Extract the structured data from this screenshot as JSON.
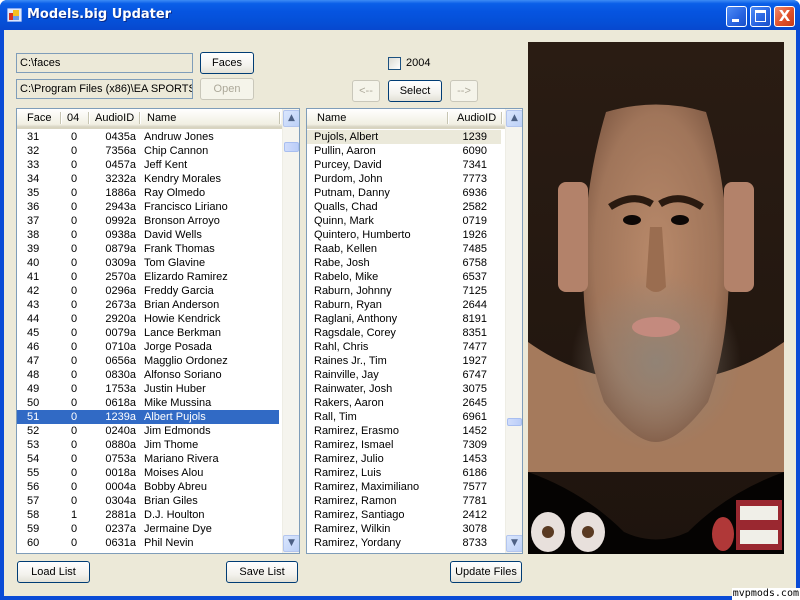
{
  "window": {
    "title": "Models.big Updater",
    "app_icon": "app-window-icon",
    "controls": {
      "minimize": "minimize-icon",
      "maximize": "maximize-icon",
      "close_glyph": "X"
    }
  },
  "paths": {
    "faces_path": "C:\\faces",
    "game_path": "C:\\Program Files (x86)\\EA SPORTS"
  },
  "buttons": {
    "faces": "Faces",
    "open": "Open",
    "prev": "<--",
    "select": "Select",
    "next": "-->",
    "load_list": "Load List",
    "save_list": "Save List",
    "update_files": "Update Files"
  },
  "checkbox_2004": {
    "label": "2004",
    "checked": false
  },
  "face_list": {
    "columns": [
      "Face",
      "04",
      "AudioID",
      "Name"
    ],
    "selected_face": "51",
    "rows": [
      [
        "31",
        "0",
        "0435a",
        "Andruw Jones"
      ],
      [
        "32",
        "0",
        "7356a",
        "Chip Cannon"
      ],
      [
        "33",
        "0",
        "0457a",
        "Jeff Kent"
      ],
      [
        "34",
        "0",
        "3232a",
        "Kendry Morales"
      ],
      [
        "35",
        "0",
        "1886a",
        "Ray Olmedo"
      ],
      [
        "36",
        "0",
        "2943a",
        "Francisco Liriano"
      ],
      [
        "37",
        "0",
        "0992a",
        "Bronson Arroyo"
      ],
      [
        "38",
        "0",
        "0938a",
        "David Wells"
      ],
      [
        "39",
        "0",
        "0879a",
        "Frank Thomas"
      ],
      [
        "40",
        "0",
        "0309a",
        "Tom Glavine"
      ],
      [
        "41",
        "0",
        "2570a",
        "Elizardo Ramirez"
      ],
      [
        "42",
        "0",
        "0296a",
        "Freddy Garcia"
      ],
      [
        "43",
        "0",
        "2673a",
        "Brian Anderson"
      ],
      [
        "44",
        "0",
        "2920a",
        "Howie Kendrick"
      ],
      [
        "45",
        "0",
        "0079a",
        "Lance Berkman"
      ],
      [
        "46",
        "0",
        "0710a",
        "Jorge Posada"
      ],
      [
        "47",
        "0",
        "0656a",
        "Magglio Ordonez"
      ],
      [
        "48",
        "0",
        "0830a",
        "Alfonso Soriano"
      ],
      [
        "49",
        "0",
        "1753a",
        "Justin Huber"
      ],
      [
        "50",
        "0",
        "0618a",
        "Mike Mussina"
      ],
      [
        "51",
        "0",
        "1239a",
        "Albert Pujols"
      ],
      [
        "52",
        "0",
        "0240a",
        "Jim Edmonds"
      ],
      [
        "53",
        "0",
        "0880a",
        "Jim Thome"
      ],
      [
        "54",
        "0",
        "0753a",
        "Mariano Rivera"
      ],
      [
        "55",
        "0",
        "0018a",
        "Moises Alou"
      ],
      [
        "56",
        "0",
        "0004a",
        "Bobby Abreu"
      ],
      [
        "57",
        "0",
        "0304a",
        "Brian Giles"
      ],
      [
        "58",
        "1",
        "2881a",
        "D.J. Houlton"
      ],
      [
        "59",
        "0",
        "0237a",
        "Jermaine Dye"
      ],
      [
        "60",
        "0",
        "0631a",
        "Phil Nevin"
      ]
    ],
    "scroll_position": 0.05
  },
  "audio_list": {
    "columns": [
      "Name",
      "AudioID"
    ],
    "highlighted_name": "Pujols, Albert",
    "rows": [
      [
        "Pujols, Albert",
        "1239"
      ],
      [
        "Pullin, Aaron",
        "6090"
      ],
      [
        "Purcey, David",
        "7341"
      ],
      [
        "Purdom, John",
        "7773"
      ],
      [
        "Putnam, Danny",
        "6936"
      ],
      [
        "Qualls, Chad",
        "2582"
      ],
      [
        "Quinn, Mark",
        "0719"
      ],
      [
        "Quintero, Humberto",
        "1926"
      ],
      [
        "Raab, Kellen",
        "7485"
      ],
      [
        "Rabe, Josh",
        "6758"
      ],
      [
        "Rabelo, Mike",
        "6537"
      ],
      [
        "Raburn, Johnny",
        "7125"
      ],
      [
        "Raburn, Ryan",
        "2644"
      ],
      [
        "Raglani, Anthony",
        "8191"
      ],
      [
        "Ragsdale, Corey",
        "8351"
      ],
      [
        "Rahl, Chris",
        "7477"
      ],
      [
        "Raines Jr., Tim",
        "1927"
      ],
      [
        "Rainville, Jay",
        "6747"
      ],
      [
        "Rainwater, Josh",
        "3075"
      ],
      [
        "Rakers, Aaron",
        "2645"
      ],
      [
        "Rall, Tim",
        "6961"
      ],
      [
        "Ramirez, Erasmo",
        "1452"
      ],
      [
        "Ramirez, Ismael",
        "7309"
      ],
      [
        "Ramirez, Julio",
        "1453"
      ],
      [
        "Ramirez, Luis",
        "6186"
      ],
      [
        "Ramirez, Maximiliano",
        "7577"
      ],
      [
        "Ramirez, Ramon",
        "7781"
      ],
      [
        "Ramirez, Santiago",
        "2412"
      ],
      [
        "Ramirez, Wilkin",
        "3078"
      ],
      [
        "Ramirez, Yordany",
        "8733"
      ]
    ],
    "scroll_position": 0.72
  },
  "preview": {
    "description": "Face texture preview (unwrapped head texture with eyes, mouth and teeth)"
  },
  "watermark": "mvpmods.com",
  "colors": {
    "title_bar": "#0550d8",
    "client_bg": "#ece9d8",
    "selection": "#316ac5",
    "close_button": "#e0502a"
  }
}
